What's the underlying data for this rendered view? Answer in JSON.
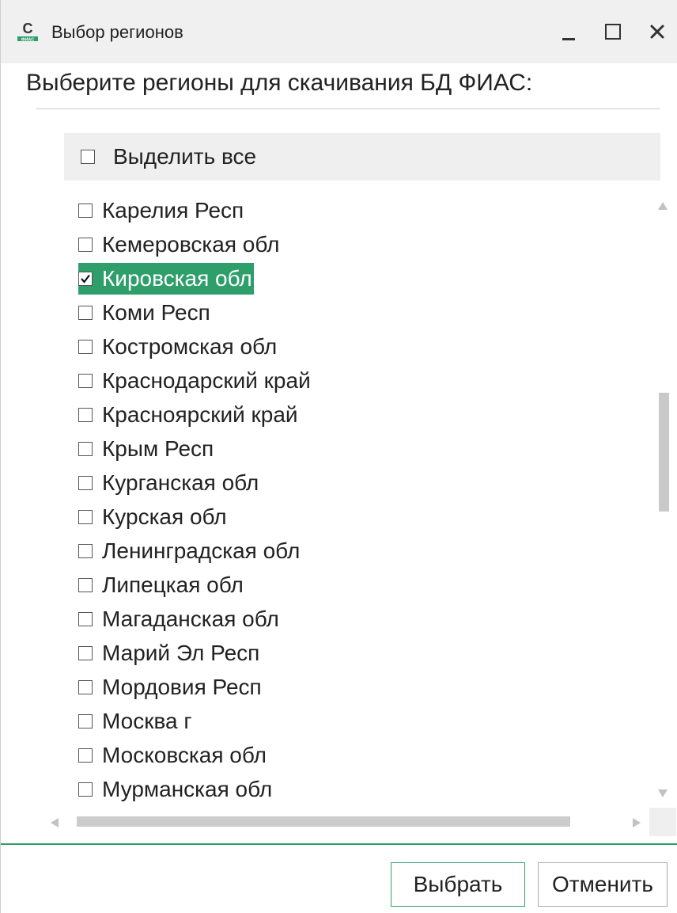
{
  "window": {
    "title": "Выбор регионов",
    "icon_letter": "C",
    "icon_caption": "ФИАС"
  },
  "header": {
    "label": "Выберите регионы для скачивания БД ФИАС:"
  },
  "select_all": {
    "label": "Выделить все",
    "checked": false
  },
  "regions": [
    {
      "label": "Карелия Респ",
      "checked": false,
      "selected": false
    },
    {
      "label": "Кемеровская обл",
      "checked": false,
      "selected": false
    },
    {
      "label": "Кировская обл",
      "checked": true,
      "selected": true
    },
    {
      "label": "Коми Респ",
      "checked": false,
      "selected": false
    },
    {
      "label": "Костромская обл",
      "checked": false,
      "selected": false
    },
    {
      "label": "Краснодарский край",
      "checked": false,
      "selected": false
    },
    {
      "label": "Красноярский край",
      "checked": false,
      "selected": false
    },
    {
      "label": "Крым Респ",
      "checked": false,
      "selected": false
    },
    {
      "label": "Курганская обл",
      "checked": false,
      "selected": false
    },
    {
      "label": "Курская обл",
      "checked": false,
      "selected": false
    },
    {
      "label": "Ленинградская обл",
      "checked": false,
      "selected": false
    },
    {
      "label": "Липецкая обл",
      "checked": false,
      "selected": false
    },
    {
      "label": "Магаданская обл",
      "checked": false,
      "selected": false
    },
    {
      "label": "Марий Эл Респ",
      "checked": false,
      "selected": false
    },
    {
      "label": "Мордовия Респ",
      "checked": false,
      "selected": false
    },
    {
      "label": "Москва г",
      "checked": false,
      "selected": false
    },
    {
      "label": "Московская обл",
      "checked": false,
      "selected": false
    },
    {
      "label": "Мурманская обл",
      "checked": false,
      "selected": false
    }
  ],
  "buttons": {
    "ok_label": "Выбрать",
    "cancel_label": "Отменить"
  },
  "colors": {
    "accent": "#2e9e6a",
    "titlebar": "#f0f0f0"
  }
}
